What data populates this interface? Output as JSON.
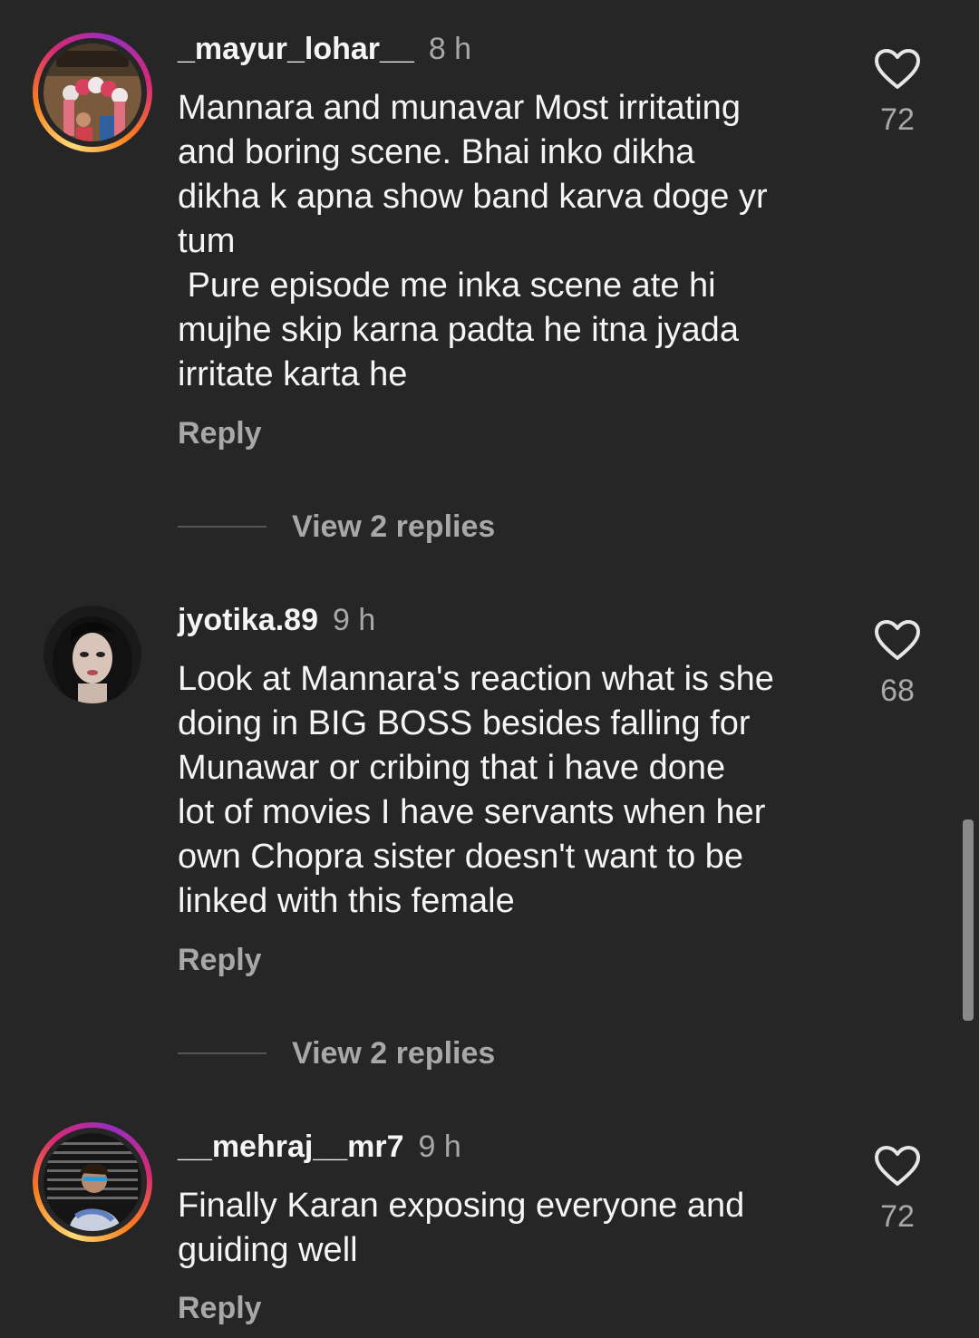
{
  "colors": {
    "background": "#262626",
    "primary_text": "#f5f5f5",
    "secondary_text": "#a8a8a8",
    "story_ring": [
      "#feda75",
      "#fa7e1e",
      "#d62976",
      "#962fbf"
    ]
  },
  "comments": [
    {
      "username": "_mayur_lohar__",
      "time": "8 h",
      "text": "Mannara and munavar Most irritating\nand boring scene. Bhai inko dikha\ndikha k apna show band karva doge yr\ntum\n Pure episode me inka scene ate hi\nmujhe skip karna padta he itna jyada\nirritate karta he",
      "reply_label": "Reply",
      "likes": "72",
      "view_replies_label": "View 2 replies",
      "like_icon": "heart-outline-icon"
    },
    {
      "username": "jyotika.89",
      "time": "9 h",
      "text": "Look at Mannara's reaction what is she\ndoing in BIG BOSS besides falling for\nMunawar or cribing that i have done\nlot of movies I have servants when her\nown Chopra sister doesn't want to be\nlinked with this female",
      "reply_label": "Reply",
      "likes": "68",
      "view_replies_label": "View 2 replies",
      "like_icon": "heart-outline-icon"
    },
    {
      "username": "__mehraj__mr7",
      "time": "9 h",
      "text": "Finally Karan exposing everyone and\nguiding well",
      "reply_label": "Reply",
      "likes": "72",
      "like_icon": "heart-outline-icon"
    }
  ]
}
